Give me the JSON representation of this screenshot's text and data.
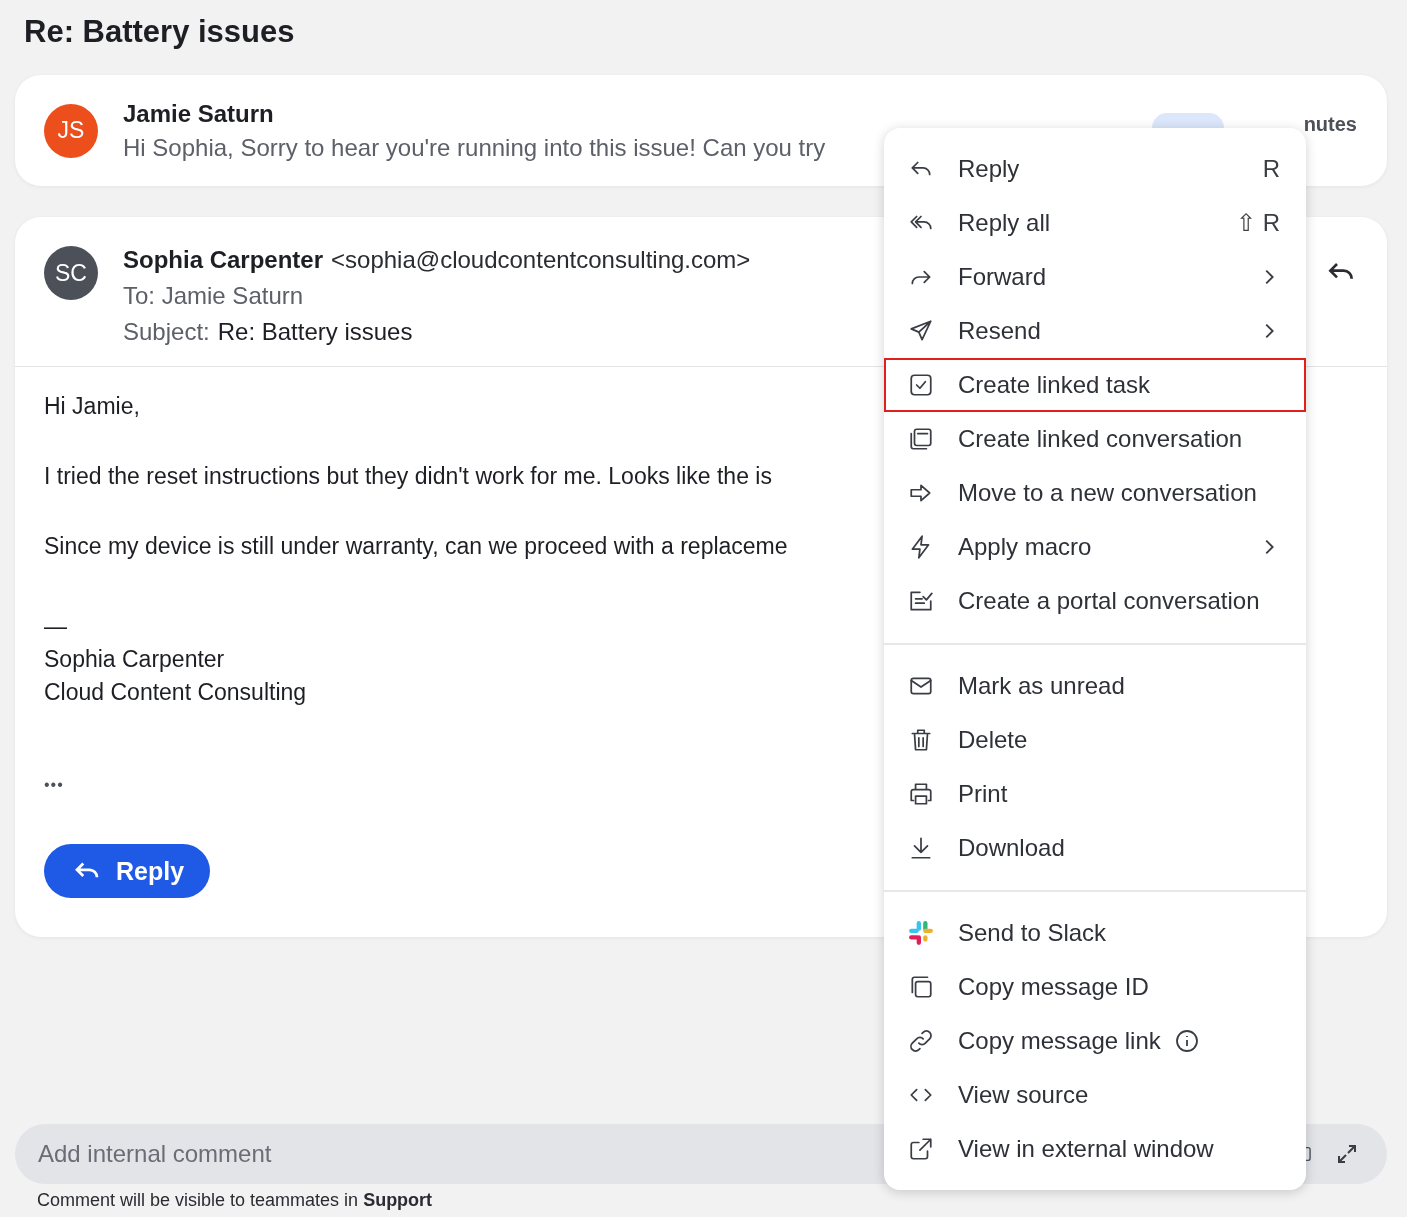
{
  "title": "Re: Battery issues",
  "previous_message": {
    "initials": "JS",
    "sender": "Jamie Saturn",
    "preview": "Hi Sophia, Sorry to hear you're running into this issue! Can you try",
    "time": "nutes"
  },
  "message": {
    "initials": "SC",
    "sender": "Sophia Carpenter",
    "email": "<sophia@cloudcontentconsulting.com>",
    "to": "To: Jamie Saturn",
    "subject_label": "Subject:",
    "subject": "Re: Battery issues",
    "body": [
      "Hi Jamie,",
      "I tried the reset instructions but they didn't work for me. Looks like the is",
      "Since my device is still under warranty, can we proceed with a replaceme"
    ],
    "signature": [
      "—",
      "Sophia Carpenter",
      "Cloud Content Consulting"
    ],
    "more": "•••",
    "reply_button": "Reply"
  },
  "menu": {
    "groups": [
      [
        {
          "label": "Reply",
          "shortcut": "R",
          "submenu": false,
          "highlighted": false
        },
        {
          "label": "Reply all",
          "shortcut": "⇧ R",
          "submenu": false,
          "highlighted": false
        },
        {
          "label": "Forward",
          "submenu": true,
          "highlighted": false
        },
        {
          "label": "Resend",
          "submenu": true,
          "highlighted": false
        },
        {
          "label": "Create linked task",
          "submenu": false,
          "highlighted": true
        },
        {
          "label": "Create linked conversation",
          "submenu": false,
          "highlighted": false
        },
        {
          "label": "Move to a new conversation",
          "submenu": false,
          "highlighted": false
        },
        {
          "label": "Apply macro",
          "submenu": true,
          "highlighted": false
        },
        {
          "label": "Create a portal conversation",
          "submenu": false,
          "highlighted": false
        }
      ],
      [
        {
          "label": "Mark as unread",
          "submenu": false,
          "highlighted": false
        },
        {
          "label": "Delete",
          "submenu": false,
          "highlighted": false
        },
        {
          "label": "Print",
          "submenu": false,
          "highlighted": false
        },
        {
          "label": "Download",
          "submenu": false,
          "highlighted": false
        }
      ],
      [
        {
          "label": "Send to Slack",
          "submenu": false,
          "highlighted": false
        },
        {
          "label": "Copy message ID",
          "submenu": false,
          "highlighted": false
        },
        {
          "label": "Copy message link",
          "submenu": false,
          "info": true,
          "highlighted": false
        },
        {
          "label": "View source",
          "submenu": false,
          "highlighted": false
        },
        {
          "label": "View in external window",
          "submenu": false,
          "highlighted": false
        }
      ]
    ]
  },
  "comment": {
    "placeholder": "Add internal comment",
    "note": "Comment will be visible to teammates in **Support**"
  }
}
